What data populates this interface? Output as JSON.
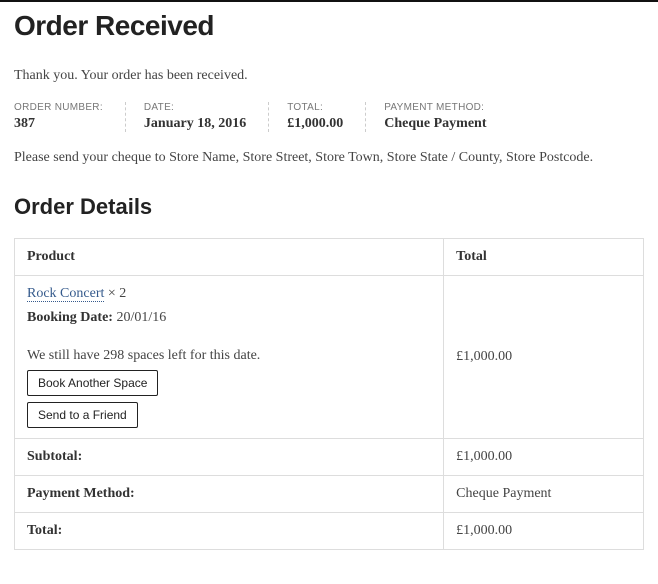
{
  "page": {
    "title": "Order Received",
    "thankyou": "Thank you. Your order has been received.",
    "instructions": "Please send your cheque to Store Name, Store Street, Store Town, Store State / County, Store Postcode."
  },
  "overview": {
    "order_number": {
      "label": "ORDER NUMBER:",
      "value": "387"
    },
    "date": {
      "label": "DATE:",
      "value": "January 18, 2016"
    },
    "total": {
      "label": "TOTAL:",
      "value": "£1,000.00"
    },
    "payment_method": {
      "label": "PAYMENT METHOD:",
      "value": "Cheque Payment"
    }
  },
  "details": {
    "heading": "Order Details",
    "columns": {
      "product": "Product",
      "total": "Total"
    },
    "item": {
      "name": "Rock Concert",
      "qty": "× 2",
      "booking_label": "Booking Date:",
      "booking_date": "20/01/16",
      "spaces_left": "We still have 298 spaces left for this date.",
      "book_another": "Book Another Space",
      "send_friend": "Send to a Friend",
      "total": "£1,000.00"
    },
    "summary": {
      "subtotal_label": "Subtotal:",
      "subtotal_value": "£1,000.00",
      "payment_label": "Payment Method:",
      "payment_value": "Cheque Payment",
      "total_label": "Total:",
      "total_value": "£1,000.00"
    }
  }
}
